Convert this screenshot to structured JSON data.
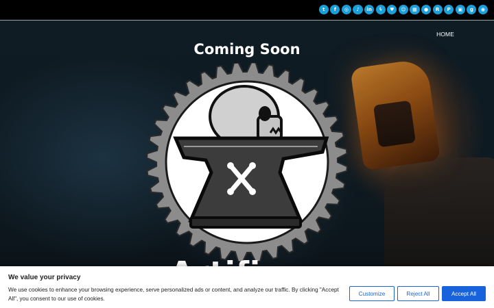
{
  "social_bar": {
    "icons": [
      {
        "name": "twitter-icon",
        "glyph": "t"
      },
      {
        "name": "facebook-icon",
        "glyph": "f"
      },
      {
        "name": "instagram-icon",
        "glyph": "◎"
      },
      {
        "name": "tiktok-icon",
        "glyph": "♪"
      },
      {
        "name": "linkedin-icon",
        "glyph": "in"
      },
      {
        "name": "messenger-icon",
        "glyph": "ϟ"
      },
      {
        "name": "bluesky-icon",
        "glyph": "♥"
      },
      {
        "name": "snapchat-icon",
        "glyph": "☺"
      },
      {
        "name": "microsoft-icon",
        "glyph": "▦"
      },
      {
        "name": "reddit-icon",
        "glyph": "●"
      },
      {
        "name": "rumble-icon",
        "glyph": "R"
      },
      {
        "name": "pinterest-icon",
        "glyph": "P"
      },
      {
        "name": "twitch-icon",
        "glyph": "▣"
      },
      {
        "name": "gab-icon",
        "glyph": "g"
      },
      {
        "name": "discord-icon",
        "glyph": "◉"
      }
    ],
    "accent": "#1c9fd9"
  },
  "nav": {
    "home_label": "HOME"
  },
  "hero": {
    "heading": "Coming Soon",
    "title_partial": "Artifi"
  },
  "cookie_banner": {
    "title": "We value your privacy",
    "text": "We use cookies to enhance your browsing experience, serve personalized ads or content, and analyze our traffic. By clicking \"Accept All\", you consent to our use of cookies.",
    "customize_label": "Customize",
    "reject_label": "Reject All",
    "accept_label": "Accept All",
    "accent": "#1863dc"
  }
}
